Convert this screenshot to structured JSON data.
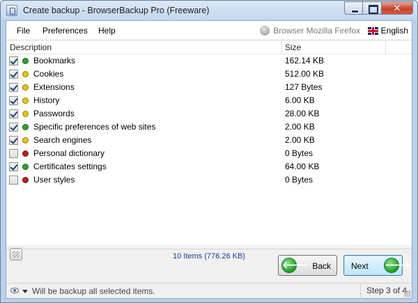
{
  "window": {
    "title": "Create backup - BrowserBackup Pro (Freeware)",
    "close_glyph": "✕"
  },
  "menu": {
    "items": [
      "File",
      "Preferences",
      "Help"
    ],
    "browser": "Browser Mozilla Firefox",
    "language": "English"
  },
  "list": {
    "columns": [
      "Description",
      "Size"
    ],
    "rows": [
      {
        "checked": true,
        "status": "green",
        "description": "Bookmarks",
        "size": "162.14 KB"
      },
      {
        "checked": true,
        "status": "yellow",
        "description": "Cookies",
        "size": "512.00 KB"
      },
      {
        "checked": true,
        "status": "yellow",
        "description": "Extensions",
        "size": "127 Bytes"
      },
      {
        "checked": true,
        "status": "yellow",
        "description": "History",
        "size": "6.00 KB"
      },
      {
        "checked": true,
        "status": "yellow",
        "description": "Passwords",
        "size": "28.00 KB"
      },
      {
        "checked": true,
        "status": "green",
        "description": "Specific preferences of web sites",
        "size": "2.00 KB"
      },
      {
        "checked": true,
        "status": "yellow",
        "description": "Search engines",
        "size": "2.00 KB"
      },
      {
        "checked": false,
        "status": "red",
        "description": "Personal dictionary",
        "size": "0 Bytes"
      },
      {
        "checked": true,
        "status": "green",
        "description": "Certificates settings",
        "size": "64.00 KB"
      },
      {
        "checked": false,
        "status": "red",
        "description": "User styles",
        "size": "0 Bytes"
      }
    ],
    "summary": "10 Items (776.26 KB)"
  },
  "status_colors": {
    "green": "#2e9e2e",
    "yellow": "#e3c41a",
    "red": "#b2221c"
  },
  "buttons": {
    "back": "Back",
    "next": "Next",
    "back_arrow": "🡐",
    "next_arrow": "🡒"
  },
  "statusbar": {
    "message": "Will be backup all selected items.",
    "step": "Step 3 of 4"
  }
}
